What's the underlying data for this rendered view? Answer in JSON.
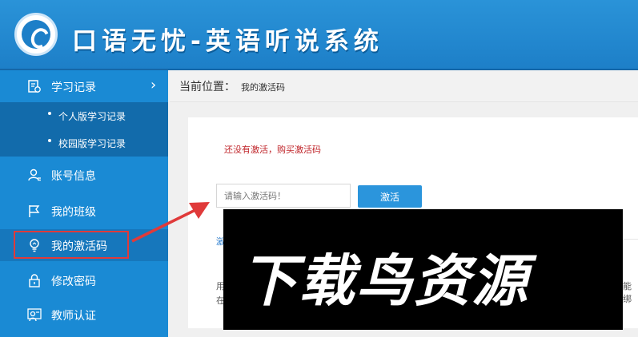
{
  "header": {
    "title": "口语无忧-英语听说系统"
  },
  "sidebar": {
    "items": [
      {
        "label": "学习记录",
        "icon": "record-icon"
      },
      {
        "label": "个人版学习记录",
        "icon": "bullet-icon"
      },
      {
        "label": "校园版学习记录",
        "icon": "bullet-icon"
      },
      {
        "label": "账号信息",
        "icon": "user-icon"
      },
      {
        "label": "我的班级",
        "icon": "flag-icon"
      },
      {
        "label": "我的激活码",
        "icon": "bulb-icon"
      },
      {
        "label": "修改密码",
        "icon": "lock-icon"
      },
      {
        "label": "教师认证",
        "icon": "teacher-icon"
      }
    ],
    "expand_chevron": "›"
  },
  "breadcrumb": {
    "label": "当前位置：",
    "current": "我的激活码"
  },
  "main": {
    "notice": "还没有激活，购买激活码",
    "input_placeholder": "请输入激活码！",
    "activate_label": "激活",
    "fragment_link": "激",
    "fragment_use": "用",
    "fragment_at": "在",
    "fragment_bind": "能绑"
  },
  "watermark": {
    "text": "下载鸟资源"
  },
  "colors": {
    "header_blue": "#2a93d8",
    "sidebar_blue": "#1a8ad4",
    "notice_red": "#c0262b",
    "button_blue": "#2b95dc",
    "highlight_red": "#e03a3a"
  }
}
